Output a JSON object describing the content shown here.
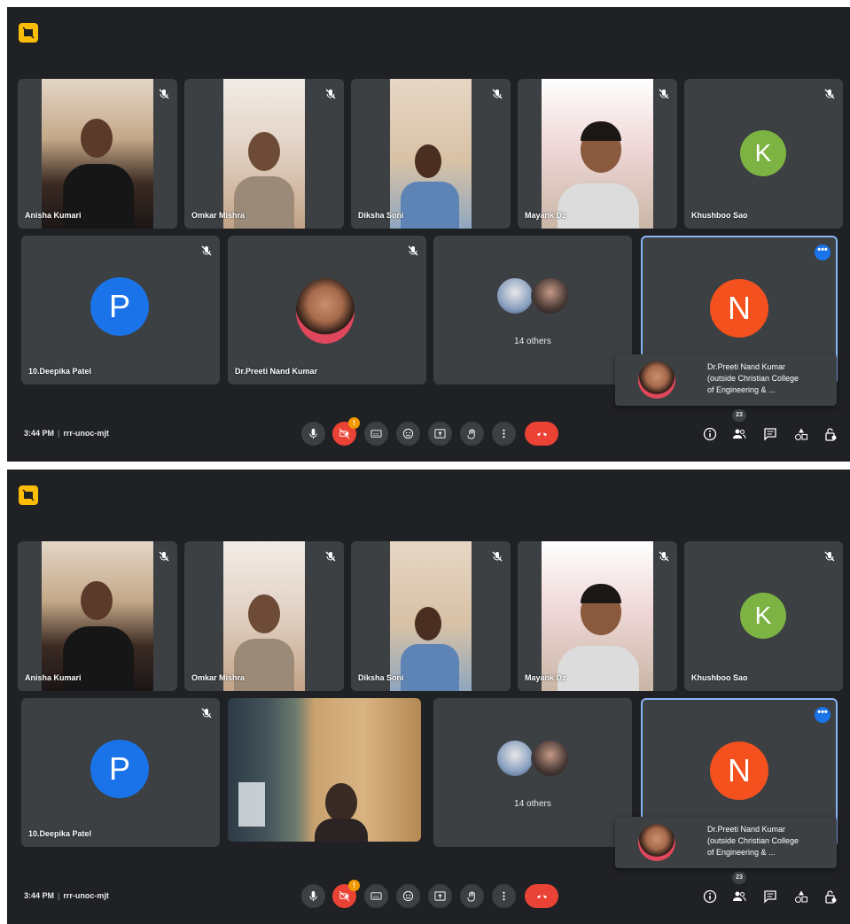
{
  "screens": [
    {
      "tiles": {
        "t1": {
          "name": "Anisha Kumari"
        },
        "t2": {
          "name": "Omkar Mishra"
        },
        "t3": {
          "name": "Diksha Soni"
        },
        "t4": {
          "name": "Mayank Dz"
        },
        "t5": {
          "name": "Khushboo Sao",
          "avatar": "K"
        },
        "t6": {
          "name": "10.Deepika Patel",
          "avatar": "P"
        },
        "t7": {
          "name": "Dr.Preeti Nand Kumar"
        },
        "t8": {
          "label": "14 others"
        },
        "t9": {
          "avatar": "N",
          "more": "•••"
        }
      },
      "popup": {
        "line1": "Dr.Preeti Nand Kumar",
        "line2": "(outside Christian College",
        "line3": "of Engineering & ..."
      },
      "bar": {
        "time": "3:44 PM",
        "separator": "|",
        "code": "rrr-unoc-mjt",
        "camera_badge": "!",
        "people_count": "23"
      }
    },
    {
      "tiles": {
        "t1": {
          "name": "Anisha Kumari"
        },
        "t2": {
          "name": "Omkar Mishra"
        },
        "t3": {
          "name": "Diksha Soni"
        },
        "t4": {
          "name": "Mayank Dz"
        },
        "t5": {
          "name": "Khushboo Sao",
          "avatar": "K"
        },
        "t6": {
          "name": "10.Deepika Patel",
          "avatar": "P"
        },
        "t8": {
          "label": "14 others"
        },
        "t9": {
          "avatar": "N",
          "more": "•••"
        }
      },
      "popup": {
        "line1": "Dr.Preeti Nand Kumar",
        "line2": "(outside Christian College",
        "line3": "of Engineering & ..."
      },
      "bar": {
        "time": "3:44 PM",
        "separator": "|",
        "code": "rrr-unoc-mjt",
        "camera_badge": "!",
        "people_count": "23"
      }
    }
  ],
  "icons": {
    "logo": "presentation-off-icon",
    "mute": "mic-off-icon",
    "controls": [
      "mic-icon",
      "camera-off-icon",
      "captions-icon",
      "emoji-icon",
      "present-icon",
      "raise-hand-icon",
      "more-vert-icon",
      "end-call-icon"
    ],
    "right_controls": [
      "info-icon",
      "people-icon",
      "chat-icon",
      "activities-icon",
      "host-controls-icon"
    ]
  },
  "colors": {
    "background": "#202124",
    "tile": "#3c4043",
    "end_call": "#ea4335",
    "active_border": "#8ab4f8",
    "avatar_k": "#7cb342",
    "avatar_p": "#1a73e8",
    "avatar_n": "#f4511e",
    "logo": "#fbbc04"
  }
}
